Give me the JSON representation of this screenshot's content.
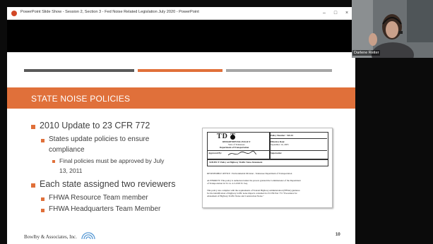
{
  "window": {
    "title": "PowerPoint Slide Show - Session 2, Section 3 - Fed Noise Related Legislation July 2020 - PowerPoint",
    "minimize": "–",
    "maximize": "□",
    "close": "×"
  },
  "slide": {
    "title": "STATE NOISE POLICIES",
    "bullets": [
      {
        "level": 1,
        "text": "2010 Update to 23 CFR 772"
      },
      {
        "level": 2,
        "text": "States update policies to ensure"
      },
      {
        "level": 2,
        "text": "compliance"
      },
      {
        "level": 3,
        "text": "Final policies must be approved by July"
      },
      {
        "level": 3,
        "text": "13, 2011"
      },
      {
        "level": 1,
        "text": "Each state assigned two reviewers"
      },
      {
        "level": 2,
        "text": "FHWA Resource Team member"
      },
      {
        "level": 2,
        "text": "FHWA Headquarters Team Member"
      }
    ],
    "document": {
      "logo": "TD  T",
      "dept": "DEPARTMENTAL POLICY",
      "state": "State of Tennessee",
      "dept_name": "Department of Transportation",
      "policy_number": "Policy Number : 520-01",
      "effective_label": "Effective Date:",
      "effective_date": "September 16, 2005",
      "approved_by": "Approved By:",
      "supersedes": "Supersedes:",
      "subject": "SUBJECT: Policy on Highway Traffic Noise Abatement",
      "responsible": "RESPONSIBLE OFFICE : Environmental Division - Tennessee Department of Transportation",
      "authority_1": "AUTHORITY: This policy is authorized under the powers granted the Commissioner of the Department",
      "authority_2": "of Transportation in T.C.A. 4-3-2303 Et. Seq.",
      "body_1": "This policy also complies with the requirements of Federal Highway Administration (FHWA) guidance",
      "body_2": "for the identification of highway traffic noise impacts contained in 23 CFR Part 772 \"Procedures for",
      "body_3": "Abatement of Highway Traffic Noise and Construction Noise.\""
    },
    "footer_company": "Bowlby & Associates, Inc.",
    "slide_number": "10"
  },
  "webcam": {
    "participant_name": "Darlene Reiter"
  },
  "colors": {
    "accent": "#e0703a",
    "dark_bar": "#595959",
    "gray_bar": "#a6a6a6"
  }
}
